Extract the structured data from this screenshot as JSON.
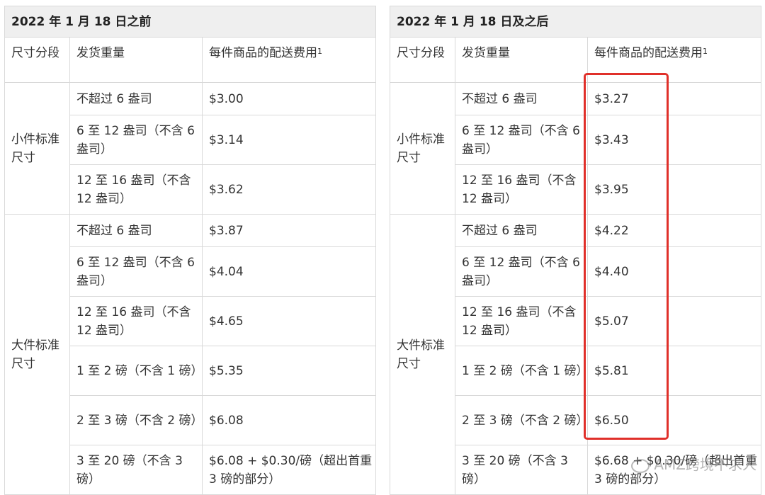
{
  "left": {
    "title": "2022 年 1 月 18 日之前",
    "headers": {
      "size": "尺寸分段",
      "weight": "发货重量",
      "fee": "每件商品的配送费用",
      "fee_sup": "1"
    },
    "small": {
      "category": "小件标准尺寸",
      "rows": [
        {
          "weight": "不超过 6 盎司",
          "fee": "$3.00"
        },
        {
          "weight": "6 至 12 盎司（不含 6 盎司）",
          "fee": "$3.14"
        },
        {
          "weight": "12 至 16 盎司（不含 12 盎司）",
          "fee": "$3.62"
        }
      ]
    },
    "large": {
      "category": "大件标准尺寸",
      "rows": [
        {
          "weight": "不超过 6 盎司",
          "fee": "$3.87"
        },
        {
          "weight": "6 至 12 盎司（不含 6 盎司）",
          "fee": "$4.04"
        },
        {
          "weight": "12 至 16 盎司（不含 12 盎司）",
          "fee": "$4.65"
        },
        {
          "weight": "1 至 2 磅（不含 1 磅）",
          "fee": "$5.35"
        },
        {
          "weight": "2 至 3 磅（不含 2 磅）",
          "fee": "$6.08"
        },
        {
          "weight": "3 至 20 磅（不含 3 磅）",
          "fee": "$6.08 + $0.30/磅（超出首重 3 磅的部分）"
        }
      ]
    }
  },
  "right": {
    "title": "2022 年 1 月 18 日及之后",
    "headers": {
      "size": "尺寸分段",
      "weight": "发货重量",
      "fee": "每件商品的配送费用",
      "fee_sup": "1"
    },
    "small": {
      "category": "小件标准尺寸",
      "rows": [
        {
          "weight": "不超过 6 盎司",
          "fee": "$3.27"
        },
        {
          "weight": "6 至 12 盎司（不含 6 盎司）",
          "fee": "$3.43"
        },
        {
          "weight": "12 至 16 盎司（不含 12 盎司）",
          "fee": "$3.95"
        }
      ]
    },
    "large": {
      "category": "大件标准尺寸",
      "rows": [
        {
          "weight": "不超过 6 盎司",
          "fee": "$4.22"
        },
        {
          "weight": "6 至 12 盎司（不含 6 盎司）",
          "fee": "$4.40"
        },
        {
          "weight": "12 至 16 盎司（不含 12 盎司）",
          "fee": "$5.07"
        },
        {
          "weight": "1 至 2 磅（不含 1 磅）",
          "fee": "$5.81"
        },
        {
          "weight": "2 至 3 磅（不含 2 磅）",
          "fee": "$6.50"
        },
        {
          "weight": "3 至 20 磅（不含 3 磅）",
          "fee": "$6.68 + $0.30/磅（超出首重 3 磅的部分）"
        }
      ]
    }
  },
  "watermark": "AMZ跨境不求人",
  "highlight_color": "#e0302a"
}
